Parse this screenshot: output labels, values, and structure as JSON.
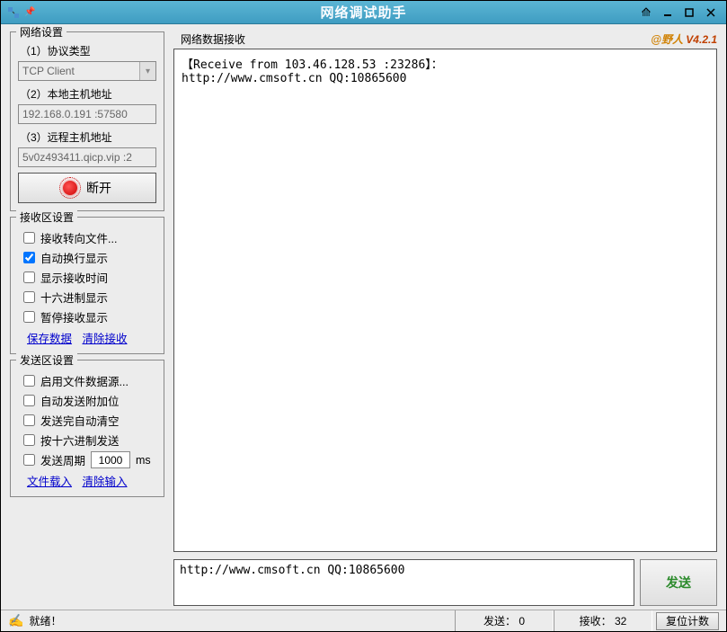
{
  "titlebar": {
    "title": "网络调试助手"
  },
  "version": {
    "at": "@野人",
    "ver": " V4.2.1"
  },
  "network_settings": {
    "title": "网络设置",
    "protocol_label": "（1）协议类型",
    "protocol_value": "TCP Client",
    "local_label": "（2）本地主机地址",
    "local_value": "192.168.0.191 :57580",
    "remote_label": "（3）远程主机地址",
    "remote_value": "5v0z493411.qicp.vip :2",
    "disconnect_label": "断开"
  },
  "recv_settings": {
    "title": "接收区设置",
    "to_file": "接收转向文件...",
    "auto_wrap": "自动换行显示",
    "show_time": "显示接收时间",
    "hex": "十六进制显示",
    "pause": "暂停接收显示",
    "save_link": "保存数据",
    "clear_link": "清除接收"
  },
  "send_settings": {
    "title": "发送区设置",
    "file_source": "启用文件数据源...",
    "auto_append": "自动发送附加位",
    "auto_clear": "发送完自动清空",
    "hex_send": "按十六进制发送",
    "period_label": "发送周期",
    "period_value": "1000",
    "period_unit": "ms",
    "load_link": "文件载入",
    "clear_link": "清除输入"
  },
  "main": {
    "recv_title": "网络数据接收",
    "recv_content": "【Receive from 103.46.128.53 :23286】：\nhttp://www.cmsoft.cn QQ:10865600",
    "send_content": "http://www.cmsoft.cn QQ:10865600",
    "send_button": "发送"
  },
  "status": {
    "ready": "就绪！",
    "sent_label": "发送：",
    "sent_value": "0",
    "recv_label": "接收：",
    "recv_value": "32",
    "reset": "复位计数"
  }
}
